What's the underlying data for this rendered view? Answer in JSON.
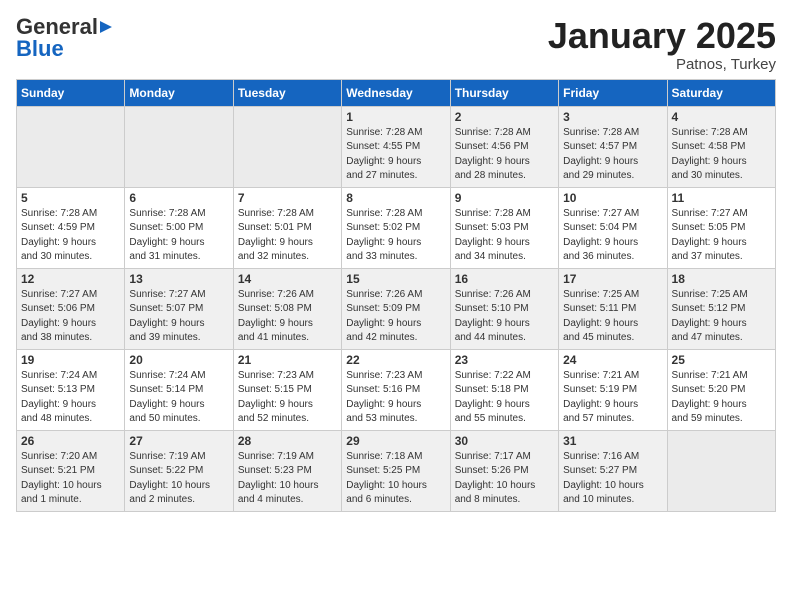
{
  "header": {
    "logo_general": "General",
    "logo_blue": "Blue",
    "month": "January 2025",
    "location": "Patnos, Turkey"
  },
  "weekdays": [
    "Sunday",
    "Monday",
    "Tuesday",
    "Wednesday",
    "Thursday",
    "Friday",
    "Saturday"
  ],
  "weeks": [
    [
      {
        "day": "",
        "info": ""
      },
      {
        "day": "",
        "info": ""
      },
      {
        "day": "",
        "info": ""
      },
      {
        "day": "1",
        "info": "Sunrise: 7:28 AM\nSunset: 4:55 PM\nDaylight: 9 hours\nand 27 minutes."
      },
      {
        "day": "2",
        "info": "Sunrise: 7:28 AM\nSunset: 4:56 PM\nDaylight: 9 hours\nand 28 minutes."
      },
      {
        "day": "3",
        "info": "Sunrise: 7:28 AM\nSunset: 4:57 PM\nDaylight: 9 hours\nand 29 minutes."
      },
      {
        "day": "4",
        "info": "Sunrise: 7:28 AM\nSunset: 4:58 PM\nDaylight: 9 hours\nand 30 minutes."
      }
    ],
    [
      {
        "day": "5",
        "info": "Sunrise: 7:28 AM\nSunset: 4:59 PM\nDaylight: 9 hours\nand 30 minutes."
      },
      {
        "day": "6",
        "info": "Sunrise: 7:28 AM\nSunset: 5:00 PM\nDaylight: 9 hours\nand 31 minutes."
      },
      {
        "day": "7",
        "info": "Sunrise: 7:28 AM\nSunset: 5:01 PM\nDaylight: 9 hours\nand 32 minutes."
      },
      {
        "day": "8",
        "info": "Sunrise: 7:28 AM\nSunset: 5:02 PM\nDaylight: 9 hours\nand 33 minutes."
      },
      {
        "day": "9",
        "info": "Sunrise: 7:28 AM\nSunset: 5:03 PM\nDaylight: 9 hours\nand 34 minutes."
      },
      {
        "day": "10",
        "info": "Sunrise: 7:27 AM\nSunset: 5:04 PM\nDaylight: 9 hours\nand 36 minutes."
      },
      {
        "day": "11",
        "info": "Sunrise: 7:27 AM\nSunset: 5:05 PM\nDaylight: 9 hours\nand 37 minutes."
      }
    ],
    [
      {
        "day": "12",
        "info": "Sunrise: 7:27 AM\nSunset: 5:06 PM\nDaylight: 9 hours\nand 38 minutes."
      },
      {
        "day": "13",
        "info": "Sunrise: 7:27 AM\nSunset: 5:07 PM\nDaylight: 9 hours\nand 39 minutes."
      },
      {
        "day": "14",
        "info": "Sunrise: 7:26 AM\nSunset: 5:08 PM\nDaylight: 9 hours\nand 41 minutes."
      },
      {
        "day": "15",
        "info": "Sunrise: 7:26 AM\nSunset: 5:09 PM\nDaylight: 9 hours\nand 42 minutes."
      },
      {
        "day": "16",
        "info": "Sunrise: 7:26 AM\nSunset: 5:10 PM\nDaylight: 9 hours\nand 44 minutes."
      },
      {
        "day": "17",
        "info": "Sunrise: 7:25 AM\nSunset: 5:11 PM\nDaylight: 9 hours\nand 45 minutes."
      },
      {
        "day": "18",
        "info": "Sunrise: 7:25 AM\nSunset: 5:12 PM\nDaylight: 9 hours\nand 47 minutes."
      }
    ],
    [
      {
        "day": "19",
        "info": "Sunrise: 7:24 AM\nSunset: 5:13 PM\nDaylight: 9 hours\nand 48 minutes."
      },
      {
        "day": "20",
        "info": "Sunrise: 7:24 AM\nSunset: 5:14 PM\nDaylight: 9 hours\nand 50 minutes."
      },
      {
        "day": "21",
        "info": "Sunrise: 7:23 AM\nSunset: 5:15 PM\nDaylight: 9 hours\nand 52 minutes."
      },
      {
        "day": "22",
        "info": "Sunrise: 7:23 AM\nSunset: 5:16 PM\nDaylight: 9 hours\nand 53 minutes."
      },
      {
        "day": "23",
        "info": "Sunrise: 7:22 AM\nSunset: 5:18 PM\nDaylight: 9 hours\nand 55 minutes."
      },
      {
        "day": "24",
        "info": "Sunrise: 7:21 AM\nSunset: 5:19 PM\nDaylight: 9 hours\nand 57 minutes."
      },
      {
        "day": "25",
        "info": "Sunrise: 7:21 AM\nSunset: 5:20 PM\nDaylight: 9 hours\nand 59 minutes."
      }
    ],
    [
      {
        "day": "26",
        "info": "Sunrise: 7:20 AM\nSunset: 5:21 PM\nDaylight: 10 hours\nand 1 minute."
      },
      {
        "day": "27",
        "info": "Sunrise: 7:19 AM\nSunset: 5:22 PM\nDaylight: 10 hours\nand 2 minutes."
      },
      {
        "day": "28",
        "info": "Sunrise: 7:19 AM\nSunset: 5:23 PM\nDaylight: 10 hours\nand 4 minutes."
      },
      {
        "day": "29",
        "info": "Sunrise: 7:18 AM\nSunset: 5:25 PM\nDaylight: 10 hours\nand 6 minutes."
      },
      {
        "day": "30",
        "info": "Sunrise: 7:17 AM\nSunset: 5:26 PM\nDaylight: 10 hours\nand 8 minutes."
      },
      {
        "day": "31",
        "info": "Sunrise: 7:16 AM\nSunset: 5:27 PM\nDaylight: 10 hours\nand 10 minutes."
      },
      {
        "day": "",
        "info": ""
      }
    ]
  ]
}
